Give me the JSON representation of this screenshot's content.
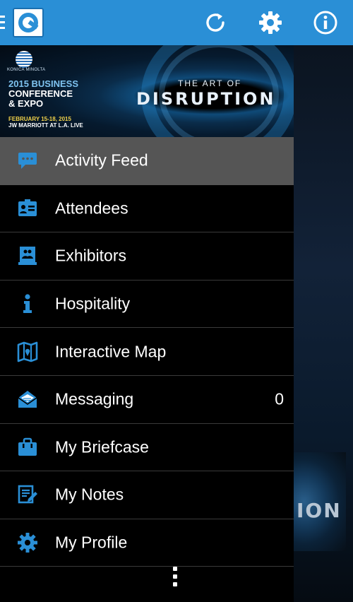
{
  "topbar": {
    "icons": [
      "menu-icon",
      "app-logo",
      "refresh-icon",
      "settings-icon",
      "info-icon"
    ],
    "color": "#2a8fd6"
  },
  "banner": {
    "brand": "KONICA MINOLTA",
    "title_line1": "2015 BUSINESS",
    "title_line2": "CONFERENCE",
    "title_line3": "& EXPO",
    "date_line1": "FEBRUARY 15-18, 2015",
    "date_line2": "JW MARRIOTT AT L.A. LIVE",
    "tagline_small": "THE ART OF",
    "tagline_big": "DISRUPTION"
  },
  "background": {
    "partial_text": "ION"
  },
  "menu": {
    "items": [
      {
        "label": "Activity Feed",
        "icon": "chat-bubble-icon",
        "active": true
      },
      {
        "label": "Attendees",
        "icon": "id-card-icon"
      },
      {
        "label": "Exhibitors",
        "icon": "exhibitor-booth-icon"
      },
      {
        "label": "Hospitality",
        "icon": "info-icon"
      },
      {
        "label": "Interactive Map",
        "icon": "map-icon"
      },
      {
        "label": "Messaging",
        "icon": "envelope-icon",
        "badge": "0"
      },
      {
        "label": "My Briefcase",
        "icon": "briefcase-icon"
      },
      {
        "label": "My Notes",
        "icon": "notes-icon"
      },
      {
        "label": "My Profile",
        "icon": "gear-icon"
      }
    ],
    "icon_color": "#2a8fd6",
    "active_bg": "#555555"
  }
}
